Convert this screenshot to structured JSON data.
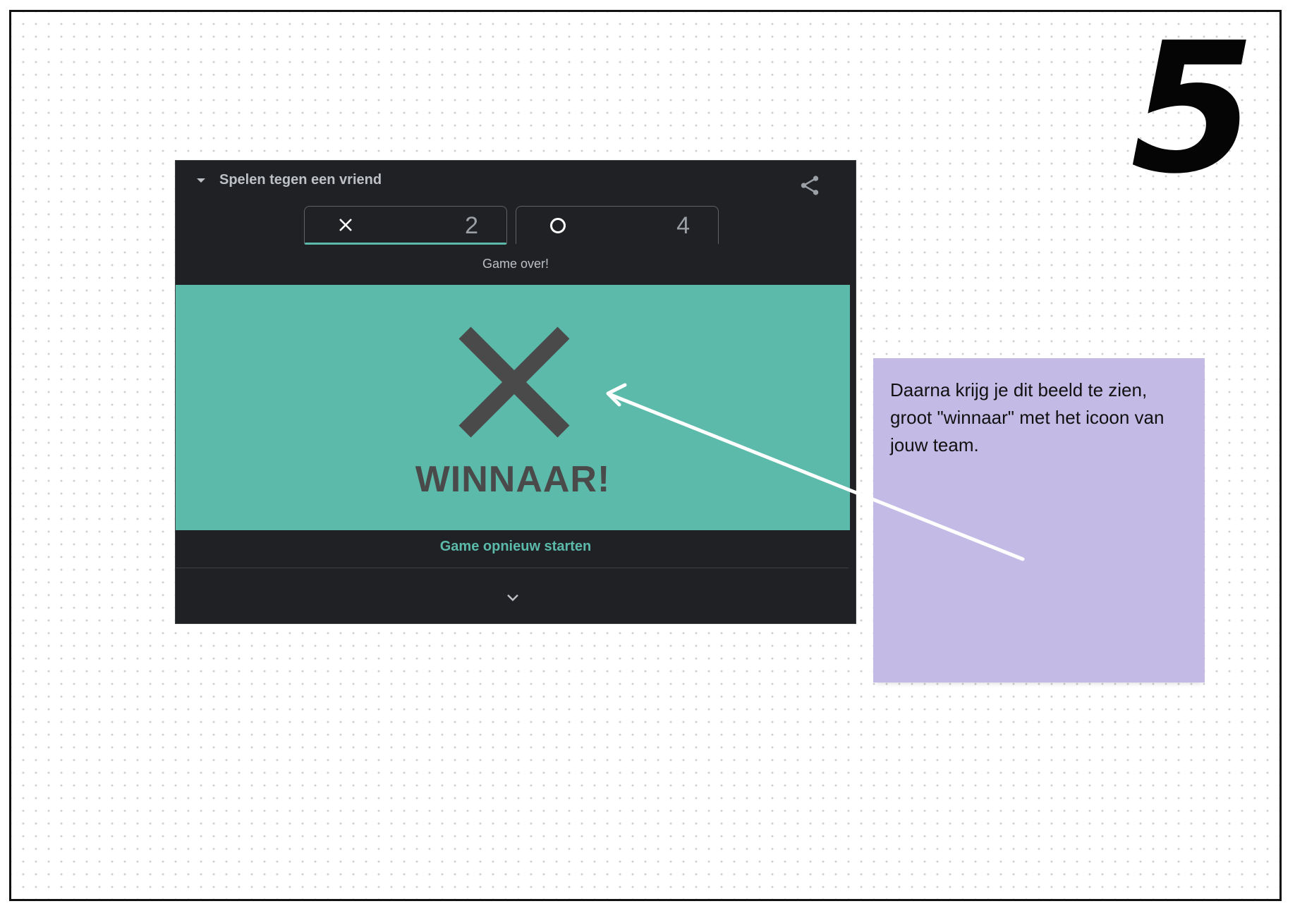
{
  "step_number": "5",
  "widget": {
    "title": "Spelen tegen een vriend",
    "tabs": [
      {
        "symbol": "X",
        "score": "2",
        "active": true
      },
      {
        "symbol": "O",
        "score": "4",
        "active": false
      }
    ],
    "status": "Game over!",
    "winner_label": "WINNAAR!",
    "restart_label": "Game opnieuw starten"
  },
  "note": {
    "text": "Daarna krijg je dit beeld te zien, groot \"winnaar\" met het icoon van jouw team."
  },
  "colors": {
    "widget_bg": "#202124",
    "accent": "#5bbaaa",
    "board_bg": "#5bbaaa",
    "winner_text": "#4a4a4a",
    "note_bg": "#c3bbe6"
  },
  "icons": [
    "chevron-down-icon",
    "share-icon",
    "x-icon",
    "o-icon",
    "big-x-icon",
    "expand-chevron-icon",
    "arrow-pointer"
  ]
}
